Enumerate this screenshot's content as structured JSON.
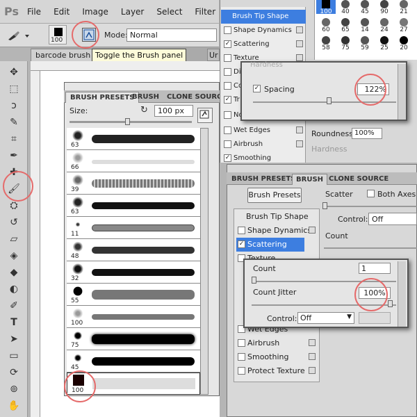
{
  "app": {
    "logo": "Ps"
  },
  "menu": [
    "File",
    "Edit",
    "Image",
    "Layer",
    "Select",
    "Filter"
  ],
  "options_bar": {
    "brush_size": "100",
    "mode_label": "Mode:",
    "mode_value": "Normal",
    "tooltip": "Toggle the Brush panel"
  },
  "document_tab": {
    "title": "barcode brush",
    "overflow_tab": "Ur"
  },
  "brush_presets_panel": {
    "tabs": [
      "BRUSH PRESETS",
      "BRUSH",
      "CLONE SOURCE"
    ],
    "active_tab": "BRUSH PRESETS",
    "size_label": "Size:",
    "size_value": "100 px",
    "presets": [
      {
        "size": "63"
      },
      {
        "size": "66"
      },
      {
        "size": "39"
      },
      {
        "size": "63"
      },
      {
        "size": "11"
      },
      {
        "size": "48"
      },
      {
        "size": "32"
      },
      {
        "size": "55"
      },
      {
        "size": "100"
      },
      {
        "size": "75"
      },
      {
        "size": "45"
      },
      {
        "size": "100"
      }
    ]
  },
  "upper_brush_panel": {
    "items": [
      "Brush Tip Shape",
      "Shape Dynamics",
      "Scattering",
      "Texture",
      "Dual Brush",
      "Color Dynamics",
      "Transfer",
      "Noise",
      "Wet Edges",
      "Airbrush",
      "Smoothing"
    ],
    "visible_items": [
      "Brush Tip Shape",
      "Shape Dynamics",
      "Scattering",
      "Texture",
      "Di",
      "Co",
      "Tr",
      "No",
      "Wet Edges",
      "Airbrush",
      "Smoothing"
    ],
    "tip_sizes": [
      "100",
      "40",
      "45",
      "90",
      "21",
      "60",
      "65",
      "14",
      "24",
      "27",
      "58",
      "75",
      "59",
      "25",
      "20"
    ],
    "roundness_label": "Roundness:",
    "roundness_value": "100%",
    "hardness_label": "Hardness"
  },
  "spacing_popup": {
    "hardness_label": "Hardness",
    "spacing_label": "Spacing",
    "spacing_value": "122%",
    "spacing_checked": true
  },
  "lower_brush_panel": {
    "tabs": [
      "BRUSH PRESETS",
      "BRUSH",
      "CLONE SOURCE"
    ],
    "active_tab": "BRUSH",
    "presets_button": "Brush Presets",
    "items": [
      "Brush Tip Shape",
      "Shape Dynamics",
      "Scattering",
      "Texture",
      "Wet Edges",
      "Airbrush",
      "Smoothing",
      "Protect Texture"
    ],
    "selected_item": "Scattering",
    "scatter_label": "Scatter",
    "both_axes_label": "Both Axes",
    "control_label": "Control:",
    "control_value": "Off",
    "count_label": "Count",
    "count_jitter_partial": "Count Jitt"
  },
  "count_popup": {
    "count_label": "Count",
    "count_value": "1",
    "count_jitter_label": "Count Jitter",
    "count_jitter_value": "100%",
    "control_label": "Control:",
    "control_value": "Off"
  },
  "colors": {
    "accent": "#3d7ee0",
    "highlight": "#e56a6a",
    "tooltip_bg": "#fdfbd9"
  }
}
